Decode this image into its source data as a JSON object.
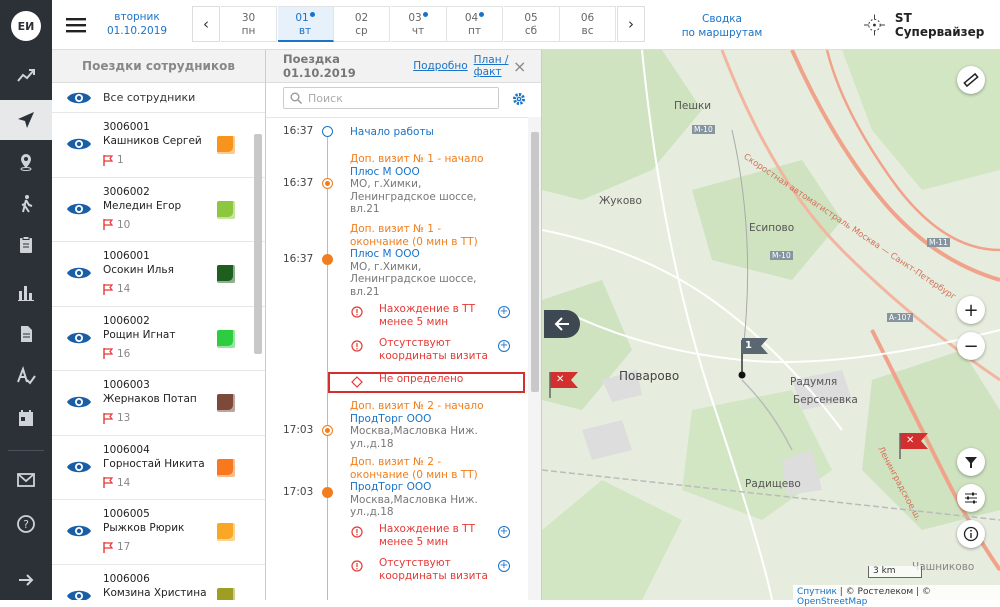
{
  "app": {
    "logo": "ЕИ",
    "user": "ST Супервайзер"
  },
  "header": {
    "weekday": "вторник",
    "date": "01.10.2019",
    "summary_line1": "Сводка",
    "summary_line2": "по маршрутам",
    "prev": "‹",
    "next": "›",
    "days": [
      {
        "num": "30",
        "wd": "пн",
        "dot": false,
        "selected": false
      },
      {
        "num": "01",
        "wd": "вт",
        "dot": true,
        "selected": true
      },
      {
        "num": "02",
        "wd": "ср",
        "dot": false,
        "selected": false
      },
      {
        "num": "03",
        "wd": "чт",
        "dot": true,
        "selected": false
      },
      {
        "num": "04",
        "wd": "пт",
        "dot": true,
        "selected": false
      },
      {
        "num": "05",
        "wd": "сб",
        "dot": false,
        "selected": false
      },
      {
        "num": "06",
        "wd": "вс",
        "dot": false,
        "selected": false
      }
    ]
  },
  "employees": {
    "title": "Поездки сотрудников",
    "all_label": "Все сотрудники",
    "items": [
      {
        "code": "3006001",
        "name": "Кашников Сергей",
        "count": "1",
        "color": "#f7941d"
      },
      {
        "code": "3006002",
        "name": "Меледин Егор",
        "count": "10",
        "color": "#8dc63f"
      },
      {
        "code": "1006001",
        "name": "Осокин Илья",
        "count": "14",
        "color": "#1e5e1e"
      },
      {
        "code": "1006002",
        "name": "Рощин Игнат",
        "count": "16",
        "color": "#2ecc40"
      },
      {
        "code": "1006003",
        "name": "Жернаков Потап",
        "count": "13",
        "color": "#7b4a3a"
      },
      {
        "code": "1006004",
        "name": "Горностай Никита",
        "count": "14",
        "color": "#f7781d"
      },
      {
        "code": "1006005",
        "name": "Рыжков Рюрик",
        "count": "17",
        "color": "#f9a825"
      },
      {
        "code": "1006006",
        "name": "Комзина Христина",
        "count": "",
        "color": "#9e9d24"
      }
    ]
  },
  "trip": {
    "title": "Поездка 01.10.2019",
    "link_details": "Подробно",
    "link_plan": "План / факт",
    "close": "×",
    "search_placeholder": "Поиск",
    "events": [
      {
        "time": "16:37",
        "title": "Начало работы",
        "kind": "start"
      },
      {
        "time": "16:37",
        "title": "Доп. визит № 1 - начало",
        "company": "Плюс М ООО",
        "address": "МО, г.Химки, Ленинградское шоссе, вл.21",
        "kind": "begin"
      },
      {
        "time": "16:37",
        "title": "Доп. визит № 1 - окончание (0 мин в ТТ)",
        "company": "Плюс М ООО",
        "address": "МО, г.Химки, Ленинградское шоссе, вл.21",
        "kind": "end"
      },
      {
        "title": "Нахождение в ТТ менее 5 мин",
        "kind": "warn"
      },
      {
        "title": "Отсутствуют координаты визита",
        "kind": "warn"
      },
      {
        "title": "Не определено",
        "kind": "undef"
      },
      {
        "time": "17:03",
        "title": "Доп. визит № 2 - начало",
        "company": "ПродТорг ООО",
        "address": "Москва,Масловка Ниж. ул.,д.18",
        "kind": "begin"
      },
      {
        "time": "17:03",
        "title": "Доп. визит № 2 - окончание (0 мин в ТТ)",
        "company": "ПродТорг ООО",
        "address": "Москва,Масловка Ниж. ул.,д.18",
        "kind": "end"
      },
      {
        "title": "Нахождение в ТТ менее 5 мин",
        "kind": "warn"
      },
      {
        "title": "Отсутствуют координаты визита",
        "kind": "warn"
      }
    ]
  },
  "map": {
    "labels": [
      "Пешки",
      "Жуково",
      "Есипово",
      "Поварово",
      "Радумля",
      "Берсеневка",
      "Радищево",
      "Чашниково",
      "Скоростная автомагистраль Москва — Санкт-Петербург",
      "Ленинградское ш."
    ],
    "road_badges": [
      "М-10",
      "М-11",
      "М-10",
      "А-107"
    ],
    "pin_number": "1",
    "zoom_in": "+",
    "zoom_out": "−",
    "scale": "3 km",
    "attribution_a": "Спутник",
    "attribution_b": " | © Ростелеком | © ",
    "attribution_c": "OpenStreetMap"
  }
}
